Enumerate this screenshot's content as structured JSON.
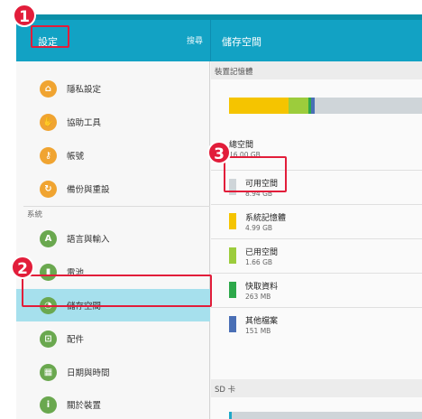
{
  "header": {
    "settings_title": "設定",
    "search_label": "搜尋",
    "storage_title": "儲存空間"
  },
  "sidebar": {
    "items_top": [
      {
        "label": "隱私設定",
        "icon": "lock-icon",
        "color": "#f0a431",
        "glyph": "⌂"
      },
      {
        "label": "協助工具",
        "icon": "hand-icon",
        "color": "#f0a431",
        "glyph": "✋"
      },
      {
        "label": "帳號",
        "icon": "key-icon",
        "color": "#f0a431",
        "glyph": "⚷"
      },
      {
        "label": "備份與重設",
        "icon": "backup-icon",
        "color": "#f0a431",
        "glyph": "↻"
      }
    ],
    "section_label": "系統",
    "items_bottom": [
      {
        "label": "語言與輸入",
        "icon": "language-icon",
        "color": "#6aa84f",
        "glyph": "A"
      },
      {
        "label": "電池",
        "icon": "battery-icon",
        "color": "#6aa84f",
        "glyph": "▮"
      },
      {
        "label": "儲存空間",
        "icon": "storage-icon",
        "color": "#6aa84f",
        "glyph": "◔",
        "selected": true
      },
      {
        "label": "配件",
        "icon": "accessory-icon",
        "color": "#6aa84f",
        "glyph": "⊡"
      },
      {
        "label": "日期與時間",
        "icon": "calendar-icon",
        "color": "#6aa84f",
        "glyph": "▦"
      },
      {
        "label": "關於裝置",
        "icon": "info-icon",
        "color": "#6aa84f",
        "glyph": "i"
      }
    ]
  },
  "main": {
    "device_section": "裝置記憶體",
    "storage_segments": [
      {
        "name": "系統記憶體",
        "fraction": 0.31,
        "color": "#f5c400"
      },
      {
        "name": "已用空間",
        "fraction": 0.1,
        "color": "#9ccc3c"
      },
      {
        "name": "快取資料",
        "fraction": 0.016,
        "color": "#2da84a"
      },
      {
        "name": "其他檔案",
        "fraction": 0.02,
        "color": "#4a6fb5"
      },
      {
        "name": "可用空間",
        "fraction": 0.554,
        "color": "#cfd5d9"
      }
    ],
    "total": {
      "title": "總空間",
      "size": "16.00 GB"
    },
    "rows": [
      {
        "title": "可用空間",
        "size": "8.94 GB",
        "color": "#cfd5d9"
      },
      {
        "title": "系統記憶體",
        "size": "4.99 GB",
        "color": "#f5c400"
      },
      {
        "title": "已用空間",
        "size": "1.66 GB",
        "color": "#9ccc3c"
      },
      {
        "title": "快取資料",
        "size": "263 MB",
        "color": "#2da84a"
      },
      {
        "title": "其他檔案",
        "size": "151 MB",
        "color": "#4a6fb5"
      }
    ],
    "sd_section": "SD 卡"
  },
  "callouts": [
    "1",
    "2",
    "3"
  ]
}
